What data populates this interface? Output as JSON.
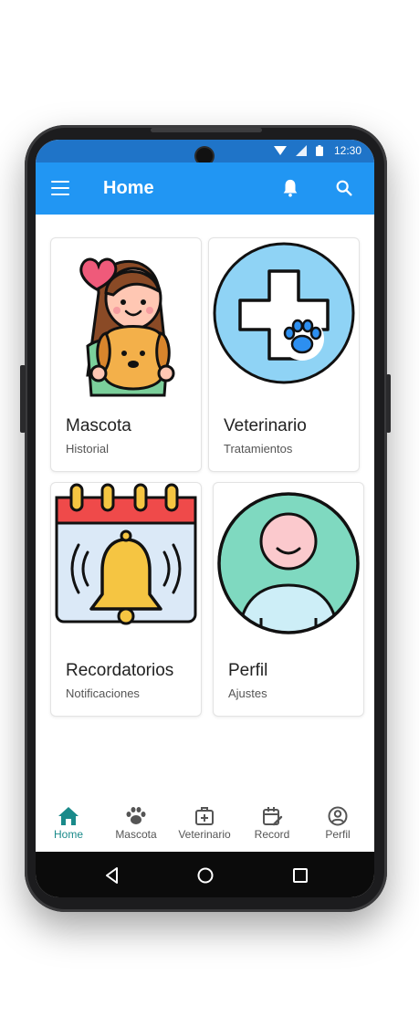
{
  "status_bar": {
    "time": "12:30"
  },
  "app_bar": {
    "title": "Home"
  },
  "cards": [
    {
      "title": "Mascota",
      "subtitle": "Historial"
    },
    {
      "title": "Veterinario",
      "subtitle": "Tratamientos"
    },
    {
      "title": "Recordatorios",
      "subtitle": "Notificaciones"
    },
    {
      "title": "Perfil",
      "subtitle": "Ajustes"
    }
  ],
  "bottom_nav": {
    "active": "Home",
    "items": [
      {
        "label": "Home",
        "icon": "home-icon"
      },
      {
        "label": "Mascota",
        "icon": "paw-icon"
      },
      {
        "label": "Veterinario",
        "icon": "medical-kit-icon"
      },
      {
        "label": "Record",
        "icon": "calendar-edit-icon"
      },
      {
        "label": "Perfil",
        "icon": "user-circle-icon"
      }
    ]
  },
  "colors": {
    "status_bar": "#1f74c8",
    "app_bar": "#2196f3",
    "nav_active": "#1a8a8a"
  }
}
